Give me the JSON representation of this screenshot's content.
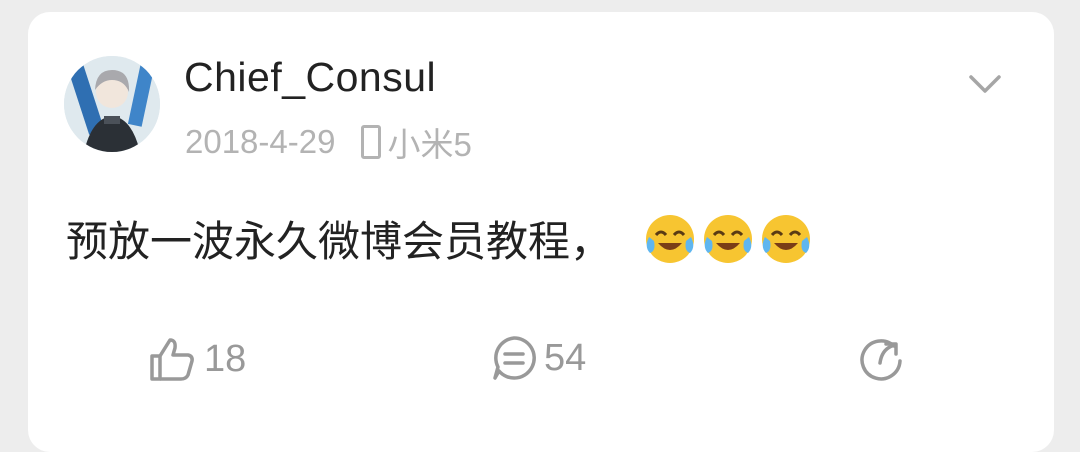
{
  "post": {
    "username": "Chief_Consul",
    "date": "2018-4-29",
    "device": "小米5",
    "text": "预放一波永久微博会员教程，",
    "emojis": [
      "laugh-cry-emoji",
      "laugh-cry-emoji",
      "laugh-cry-emoji"
    ]
  },
  "actions": {
    "like_count": "18",
    "comment_count": "54"
  },
  "icons": {
    "more": "chevron-down-icon",
    "like": "thumbs-up-icon",
    "comment": "comment-icon",
    "share": "share-icon"
  },
  "colors": {
    "text": "#222222",
    "meta": "#b3b3b3",
    "action": "#999999",
    "background": "#ededed"
  }
}
